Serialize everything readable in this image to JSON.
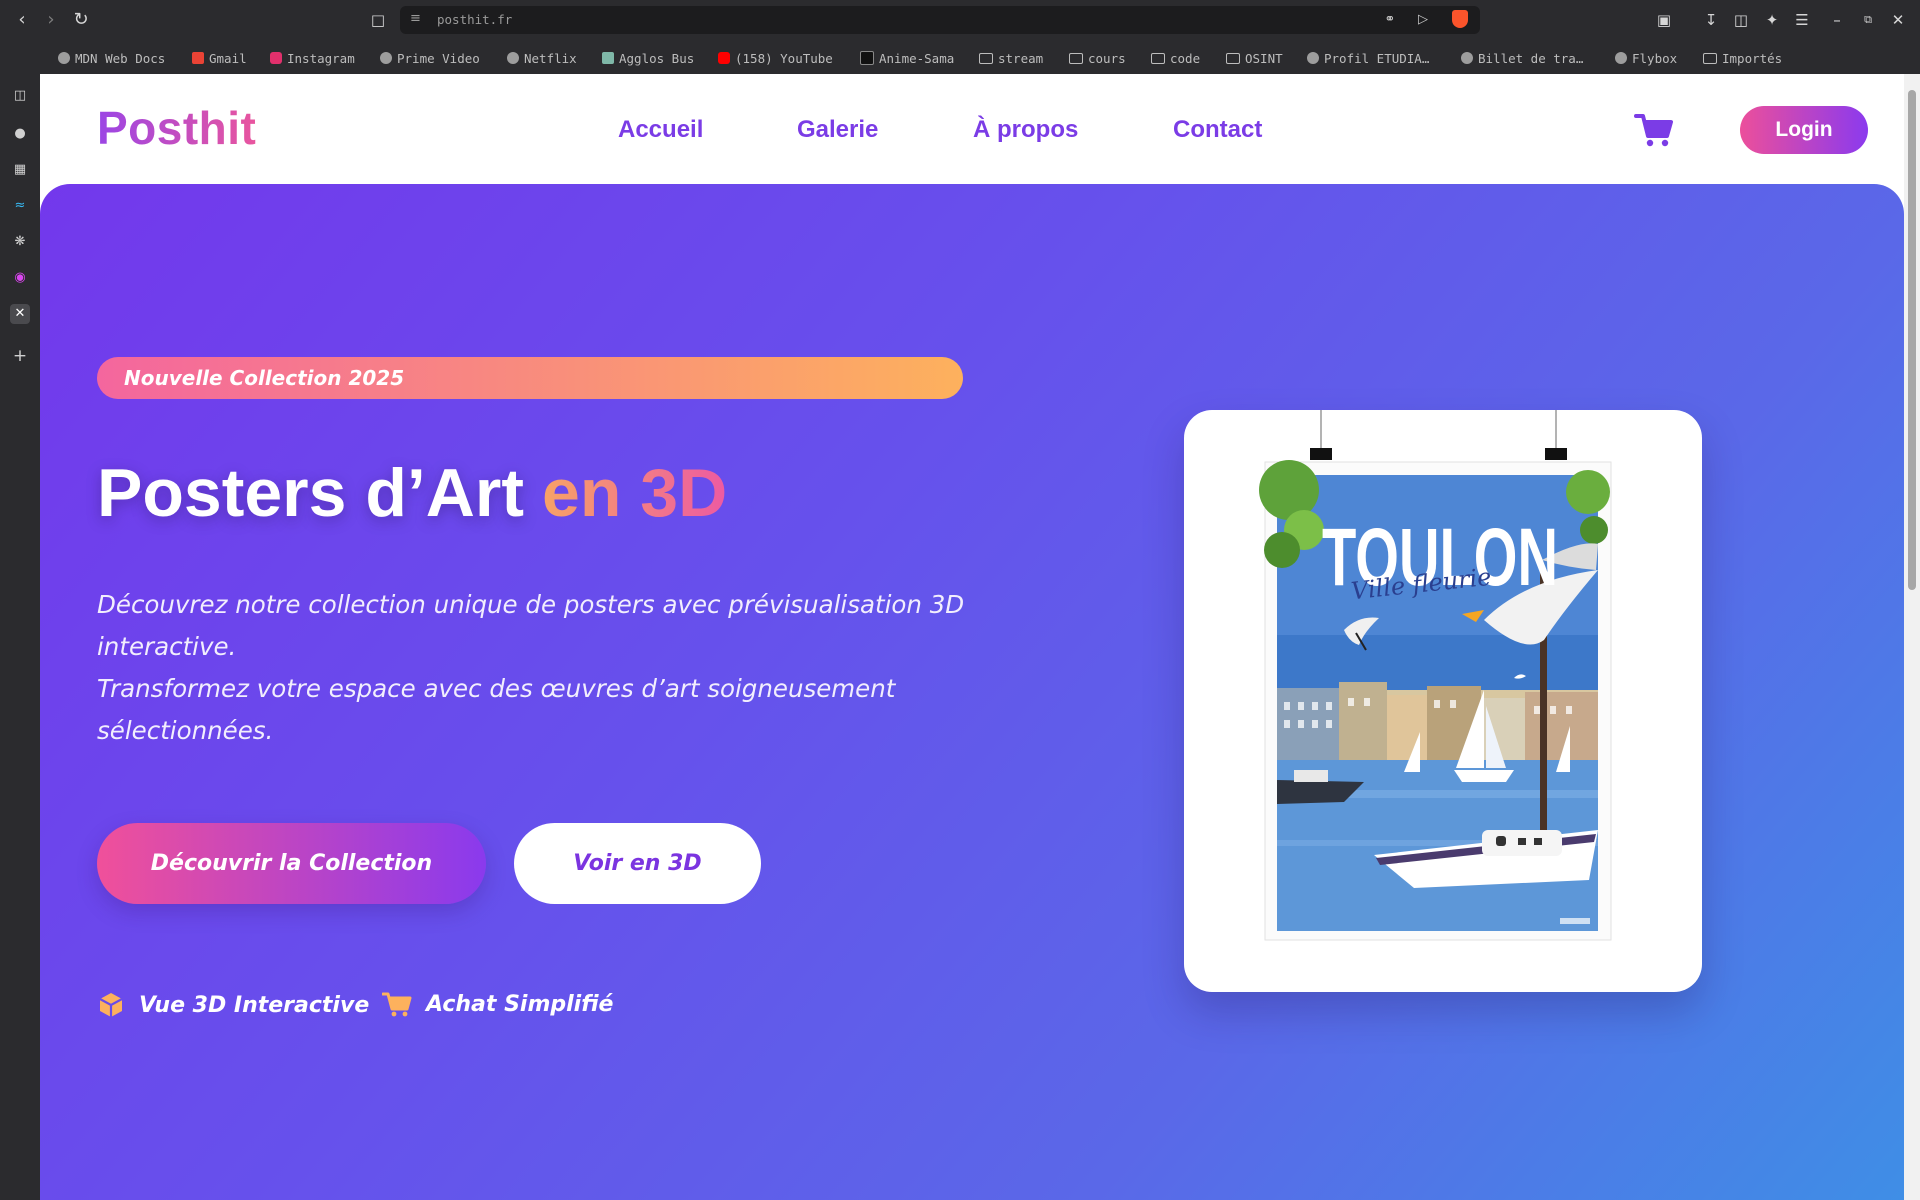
{
  "browser": {
    "url": "posthit.fr",
    "bookmarks": [
      "MDN Web Docs",
      "Gmail",
      "Instagram",
      "Prime Video",
      "Netflix",
      "Agglos Bus",
      "(158) YouTube",
      "Anime-Sama",
      "stream",
      "cours",
      "code",
      "OSINT",
      "Profil ETUDIA…",
      "Billet de tra…",
      "Flybox",
      "Importés"
    ]
  },
  "header": {
    "logo": "Posthit",
    "nav": [
      "Accueil",
      "Galerie",
      "À propos",
      "Contact"
    ],
    "login_label": "Login"
  },
  "hero": {
    "badge": "Nouvelle Collection 2025",
    "title_main": "Posters d’Art",
    "title_accent": "en 3D",
    "desc_line1": "Découvrez notre collection unique de posters avec prévisualisation 3D interactive.",
    "desc_line2": "Transformez votre espace avec des œuvres d’art soigneusement sélectionnées.",
    "cta_primary": "Découvrir la Collection",
    "cta_secondary": "Voir en 3D",
    "features": [
      "Vue 3D Interactive",
      "Achat Simplifié"
    ]
  },
  "poster": {
    "title": "TOULON",
    "subtitle": "Ville fleurie"
  },
  "colors": {
    "brand_purple": "#7b3ce6",
    "brand_pink": "#ec4f9b",
    "accent_orange": "#fdb15d"
  }
}
